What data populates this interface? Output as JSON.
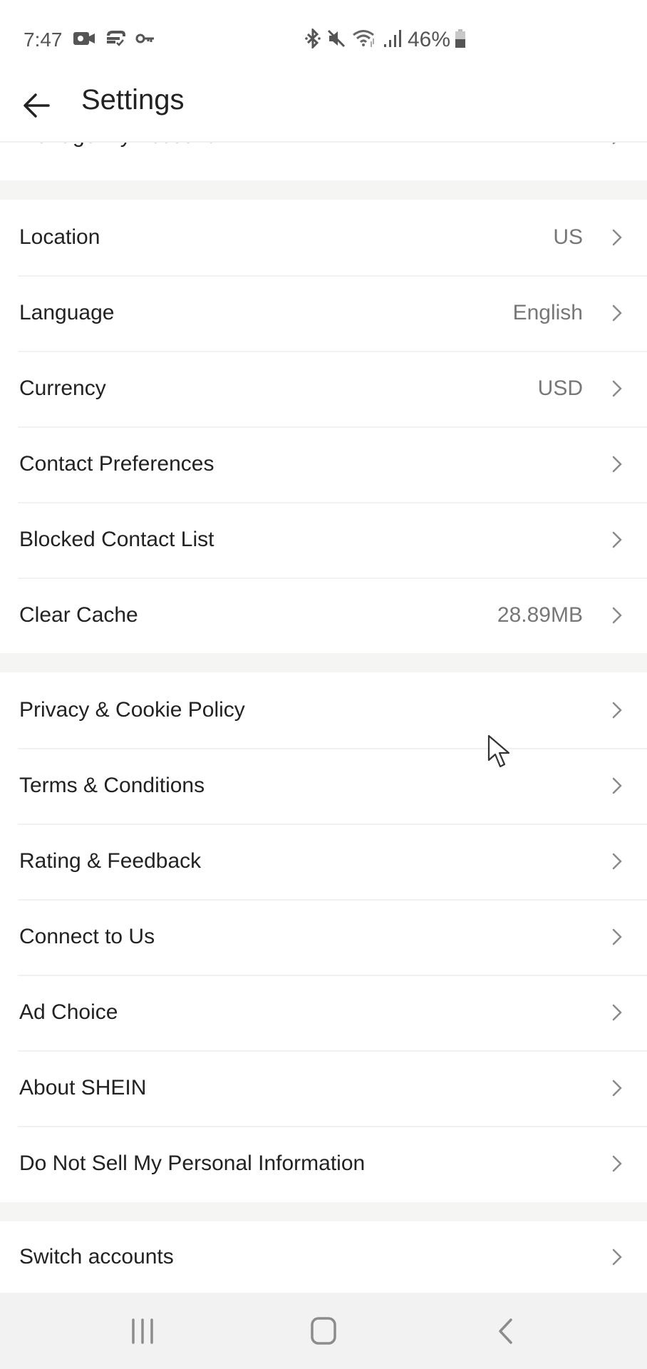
{
  "status_bar": {
    "time": "7:47",
    "left_icons": [
      "video-record-icon",
      "sync-check-icon",
      "vpn-key-icon"
    ],
    "right_icons": [
      "bluetooth-icon",
      "mute-icon",
      "wifi-icon",
      "signal-icon"
    ],
    "battery_percent": "46%"
  },
  "header": {
    "back_icon": "arrow-left-icon",
    "title": "Settings"
  },
  "partial_item": {
    "label": "Manage My Account"
  },
  "sections": [
    {
      "items": [
        {
          "label": "Location",
          "value": "US"
        },
        {
          "label": "Language",
          "value": "English"
        },
        {
          "label": "Currency",
          "value": "USD"
        },
        {
          "label": "Contact Preferences",
          "value": ""
        },
        {
          "label": "Blocked Contact List",
          "value": ""
        },
        {
          "label": "Clear Cache",
          "value": "28.89MB"
        }
      ]
    },
    {
      "items": [
        {
          "label": "Privacy & Cookie Policy",
          "value": ""
        },
        {
          "label": "Terms & Conditions",
          "value": ""
        },
        {
          "label": "Rating & Feedback",
          "value": ""
        },
        {
          "label": "Connect to Us",
          "value": ""
        },
        {
          "label": "Ad Choice",
          "value": ""
        },
        {
          "label": "About SHEIN",
          "value": ""
        },
        {
          "label": "Do Not Sell My Personal Information",
          "value": ""
        }
      ]
    },
    {
      "items": [
        {
          "label": "Switch accounts",
          "value": ""
        }
      ]
    }
  ],
  "nav_bar": {
    "buttons": [
      "recent-apps",
      "home",
      "back"
    ]
  },
  "colors": {
    "text": "#222222",
    "secondary_text": "#777777",
    "chevron": "#8a8a8a",
    "section_gap": "#f5f5f4",
    "nav_bg": "#f2f2f2"
  }
}
